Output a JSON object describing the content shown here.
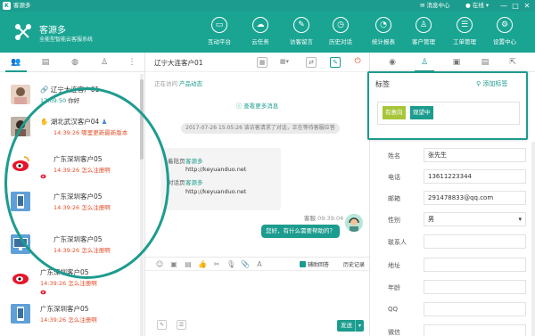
{
  "titlebar": {
    "app_name": "客源多",
    "messages": "消息中心",
    "status": "在线",
    "minimize": "—",
    "maximize": "□",
    "close": "✕"
  },
  "brand": {
    "name": "客源多",
    "subtitle": "全能型智能云客服系统"
  },
  "nav": [
    {
      "label": "互动平台",
      "icon": "monitor-icon"
    },
    {
      "label": "云任务",
      "icon": "cloud-task-icon"
    },
    {
      "label": "访客留言",
      "icon": "message-icon"
    },
    {
      "label": "历史对话",
      "icon": "history-icon"
    },
    {
      "label": "统计报表",
      "icon": "pie-chart-icon"
    },
    {
      "label": "客户管理",
      "icon": "customer-icon"
    },
    {
      "label": "工单管理",
      "icon": "ticket-icon"
    },
    {
      "label": "设置中心",
      "icon": "settings-icon"
    }
  ],
  "contacts": [
    {
      "name": "辽宁大连客户01",
      "time": "17:09:50",
      "message": "你好",
      "tag": ""
    },
    {
      "name": "湖北武汉客户04",
      "time": "14:39:26",
      "message": "哪里更新最新版本",
      "tag": ""
    },
    {
      "name": "广东深圳客户05",
      "time": "14:39:26",
      "message": "怎么注册啊",
      "tag": ""
    },
    {
      "name": "广东深圳客户05",
      "time": "14:39:26",
      "message": "怎么注册啊",
      "tag": ""
    },
    {
      "name": "广东深圳客户05",
      "time": "14:39:26",
      "message": "怎么注册啊",
      "tag": ""
    },
    {
      "name": "广东深圳客户05",
      "time": "14:39:26",
      "message": "怎么注册啊",
      "tag": ""
    },
    {
      "name": "广东深圳客户05",
      "time": "14:39:26",
      "message": "怎么注册啊",
      "tag": ""
    }
  ],
  "chat": {
    "title": "辽宁大连客户01",
    "status_label": "正在访问",
    "product_label": "产品动态",
    "more": "查看更多消息",
    "system_msg": "2017-07-26 15:05:26 该访客请求了对话，正在等待客服应答",
    "visit_label": "着陆页",
    "visit_source": "客源多",
    "visit_url": "http://keyuanduo.net",
    "page_label": "对话页",
    "page_source": "客源多",
    "page_url": "http://keyuanduo.net",
    "agent_name": "客服",
    "agent_time": "09:39:04",
    "agent_msg": "您好，有什么需要帮助的？",
    "assist_label": "辅助回答",
    "history_label": "历史记录",
    "send_label": "发送",
    "send_dropdown": "▾"
  },
  "tags_panel": {
    "title": "标签",
    "add_label": "添加标签",
    "tags": [
      {
        "label": "有意向",
        "color": "#a8c63a"
      },
      {
        "label": "观望中",
        "color": "#1c9c8e"
      }
    ]
  },
  "customer": {
    "fields": [
      {
        "label": "姓名",
        "value": "张先生"
      },
      {
        "label": "电话",
        "value": "13611223344"
      },
      {
        "label": "邮箱",
        "value": "291478833@qq.com"
      },
      {
        "label": "性别",
        "value": "男"
      },
      {
        "label": "联系人",
        "value": ""
      },
      {
        "label": "地址",
        "value": ""
      },
      {
        "label": "年龄",
        "value": ""
      },
      {
        "label": "QQ",
        "value": ""
      },
      {
        "label": "微信",
        "value": ""
      }
    ]
  },
  "colors": {
    "brand": "#1c9c8e",
    "alert": "#e2502a",
    "tag_green": "#a8c63a"
  }
}
